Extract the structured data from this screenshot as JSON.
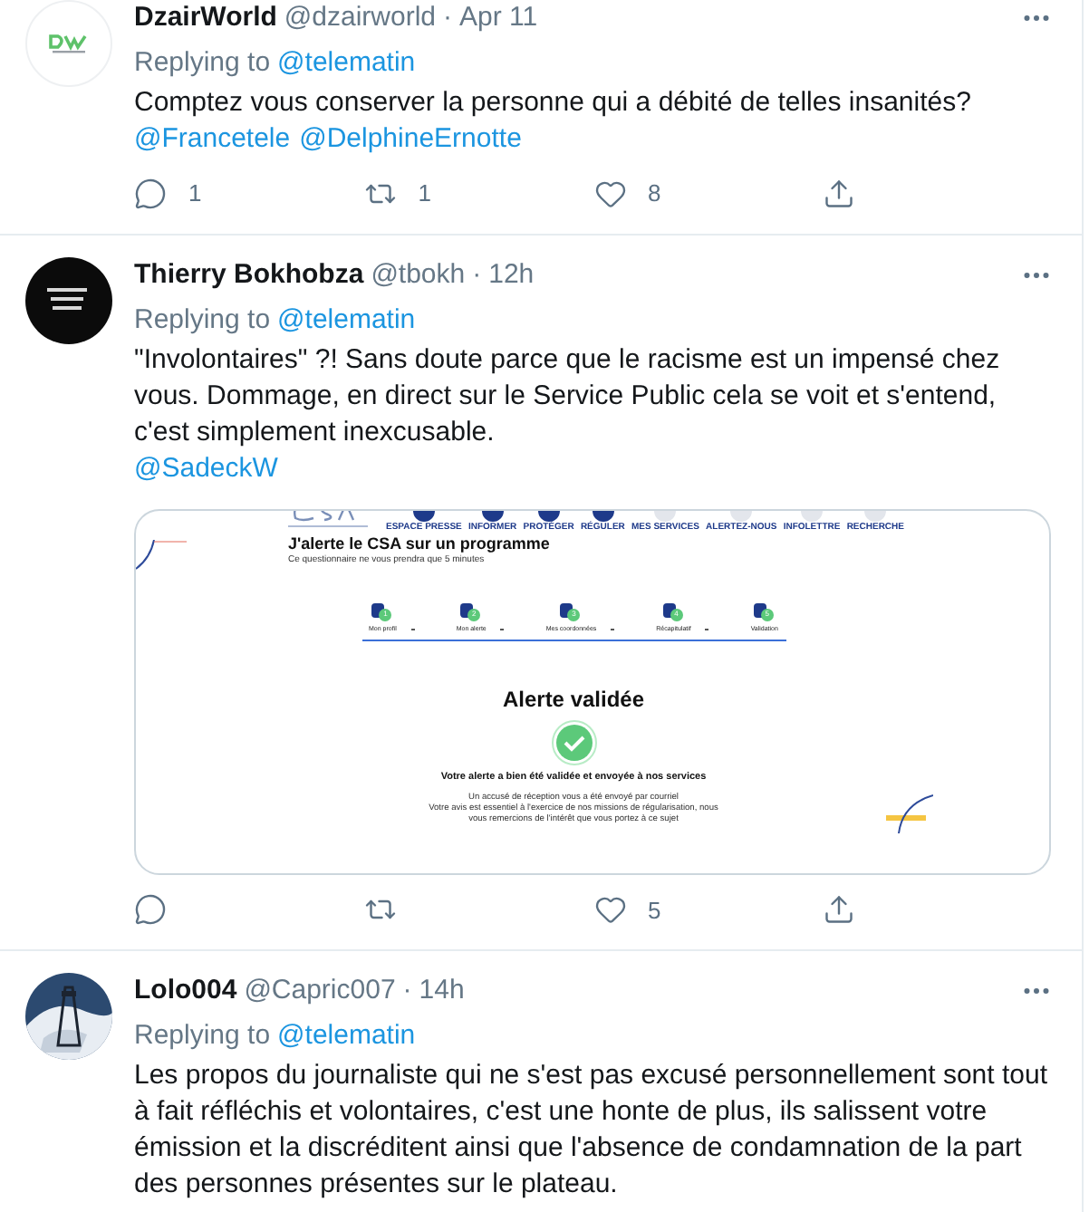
{
  "tweets": [
    {
      "name": "DzairWorld",
      "handle": "@dzairworld",
      "separator": "·",
      "time": "Apr 11",
      "reply_prefix": "Replying to",
      "reply_to": "@telematin",
      "text": "Comptez vous conserver la personne qui a débité de telles insanités?",
      "mentions": [
        "@Francetele",
        "@DelphineErnotte"
      ],
      "avatar": {
        "kind": "logo"
      },
      "counts": {
        "reply": "1",
        "retweet": "1",
        "like": "8"
      }
    },
    {
      "name": "Thierry Bokhobza",
      "handle": "@tbokh",
      "separator": "·",
      "time": "12h",
      "reply_prefix": "Replying to",
      "reply_to": "@telematin",
      "text": "\"Involontaires\" ?! Sans doute parce que le racisme est un impensé chez vous. Dommage, en direct sur le Service Public cela se voit et s'entend, c'est simplement inexcusable.",
      "mentions": [
        "@SadeckW"
      ],
      "avatar": {
        "kind": "dark"
      },
      "counts": {
        "like": "5"
      },
      "embed": {
        "nav": [
          {
            "label": "ESPACE PRESSE",
            "kind": "main"
          },
          {
            "label": "INFORMER",
            "kind": "main"
          },
          {
            "label": "PROTÉGER",
            "kind": "main"
          },
          {
            "label": "RÉGULER",
            "kind": "main"
          },
          {
            "label": "MES SERVICES",
            "kind": "tool"
          },
          {
            "label": "ALERTEZ-NOUS",
            "kind": "tool"
          },
          {
            "label": "INFOLETTRE",
            "kind": "tool"
          },
          {
            "label": "RECHERCHE",
            "kind": "tool"
          }
        ],
        "title": "J'alerte le CSA sur un programme",
        "subtitle": "Ce questionnaire ne vous prendra que 5 minutes",
        "steps": [
          {
            "number": "1",
            "label": "Mon profil"
          },
          {
            "number": "2",
            "label": "Mon alerte"
          },
          {
            "number": "3",
            "label": "Mes coordonnées"
          },
          {
            "number": "4",
            "label": "Récapitulatif"
          },
          {
            "number": "5",
            "label": "Validation"
          }
        ],
        "heading": "Alerte validée",
        "confirmation": "Votre alerte a bien été validée et envoyée à nos services",
        "note_lines": [
          "Un accusé de réception vous a été envoyé par courriel",
          "Votre avis est essentiel à l'exercice de nos missions de régularisation, nous vous remercions de l'intérêt que vous portez à ce sujet"
        ]
      }
    },
    {
      "name": "Lolo004",
      "handle": "@Capric007",
      "separator": "·",
      "time": "14h",
      "reply_prefix": "Replying to",
      "reply_to": "@telematin",
      "text": "Les propos du journaliste qui ne s'est pas excusé personnellement sont tout à fait réfléchis et volontaires, c'est une honte de plus, ils salissent votre émission et la discréditent ainsi que l'absence de condamnation de la part des personnes présentes sur le plateau."
    }
  ]
}
